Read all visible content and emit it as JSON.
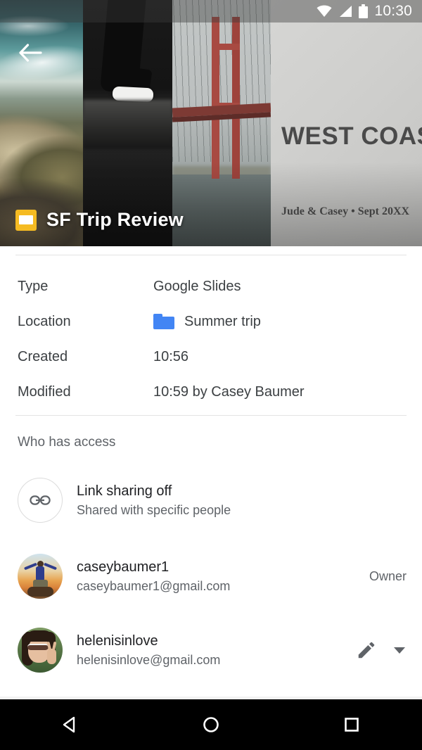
{
  "status_bar": {
    "time": "10:30",
    "icons": [
      "wifi-icon",
      "cell-signal-icon",
      "battery-icon"
    ]
  },
  "hero": {
    "back_icon": "back-arrow-icon",
    "file_type_icon": "google-slides-icon",
    "file_name": "SF Trip Review",
    "slide_title": "WEST COAST ROAD TRIP",
    "slide_subtitle": "Jude & Casey • Sept 20XX"
  },
  "details": {
    "rows": [
      {
        "label": "Type",
        "value": "Google Slides",
        "icon": null
      },
      {
        "label": "Location",
        "value": "Summer trip",
        "icon": "folder-icon"
      },
      {
        "label": "Created",
        "value": "10:56",
        "icon": null
      },
      {
        "label": "Modified",
        "value": "10:59 by Casey Baumer",
        "icon": null
      }
    ]
  },
  "access": {
    "heading": "Who has access",
    "link_sharing": {
      "icon": "link-icon",
      "title": "Link sharing off",
      "subtitle": "Shared with specific people"
    },
    "people": [
      {
        "avatar": "avatar-caseybaumer1",
        "name": "caseybaumer1",
        "email": "caseybaumer1@gmail.com",
        "role": "Owner",
        "actions": []
      },
      {
        "avatar": "avatar-helenisinlove",
        "name": "helenisinlove",
        "email": "helenisinlove@gmail.com",
        "role": "",
        "actions": [
          "edit-pencil-icon",
          "chevron-down-icon"
        ]
      }
    ]
  },
  "nav_bar": {
    "back": "back-triangle-icon",
    "home": "home-circle-icon",
    "recents": "recents-square-icon"
  },
  "colors": {
    "folder_blue": "#4285F4",
    "slides_yellow": "#F5BB22",
    "text_primary": "#202124",
    "text_secondary": "#5f6368"
  }
}
